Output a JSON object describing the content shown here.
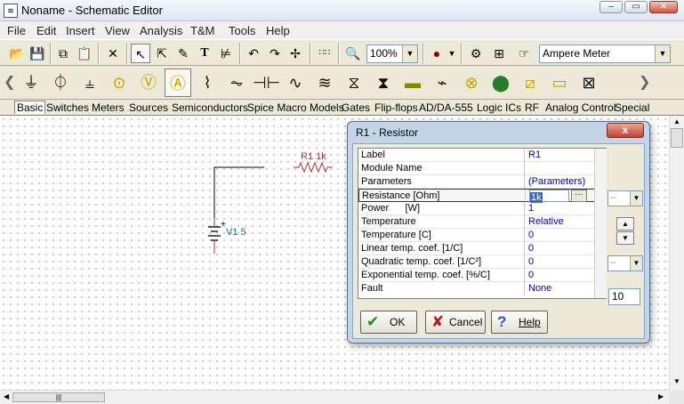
{
  "window": {
    "title": "Noname - Schematic Editor",
    "app_icon": "schematic-app-icon"
  },
  "menu": [
    "File",
    "Edit",
    "Insert",
    "View",
    "Analysis",
    "T&M",
    "Tools",
    "Help"
  ],
  "toolbar": {
    "zoom": "100%",
    "meter_select": "Ampere Meter"
  },
  "tabs": [
    "Basic",
    "Switches",
    "Meters",
    "Sources",
    "Semiconductors",
    "Spice Macro Models",
    "Gates",
    "Flip-flops",
    "AD/DA-555",
    "Logic ICs",
    "RF",
    "Analog Control",
    "Special"
  ],
  "schematic": {
    "resistor_label": "R1 1k",
    "source_label": "V1 5",
    "source_plus": "+"
  },
  "dialog": {
    "title": "R1 - Resistor",
    "close": "x",
    "rows": [
      {
        "key": "Label",
        "value": "R1"
      },
      {
        "key": "Module Name",
        "value": ""
      },
      {
        "key": "Parameters",
        "value": "(Parameters)"
      },
      {
        "key": "Resistance [Ohm]",
        "value": "1k"
      },
      {
        "key": "Power      [W]",
        "value": "1"
      },
      {
        "key": "Temperature",
        "value": "Relative"
      },
      {
        "key": "Temperature [C]",
        "value": "0"
      },
      {
        "key": "Linear temp. coef. [1/C]",
        "value": "0"
      },
      {
        "key": "Quadratic temp. coef. [1/C²]",
        "value": "0"
      },
      {
        "key": "Exponential temp. coef. [%/C]",
        "value": "0"
      },
      {
        "key": "Fault",
        "value": "None"
      }
    ],
    "step_value": "10",
    "buttons": {
      "ok": "OK",
      "cancel": "Cancel",
      "help": "Help"
    }
  },
  "colors": {
    "resistor": "#a83232",
    "source_label": "#0a7a5a",
    "dialog_frame": "#c4d5ea",
    "selection": "#3169c6"
  }
}
